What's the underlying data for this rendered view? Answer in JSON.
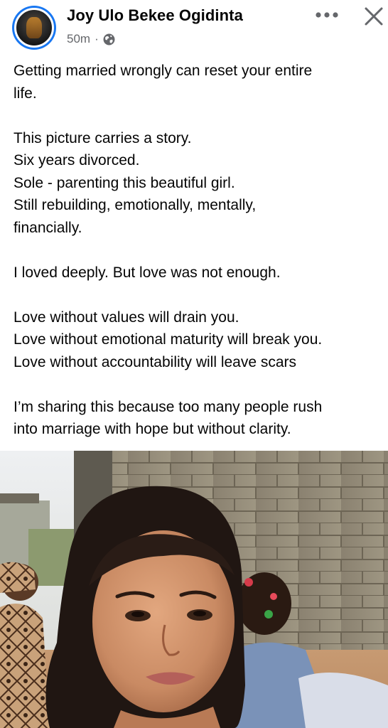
{
  "post": {
    "author": "Joy Ulo Bekee Ogidinta",
    "time": "50m",
    "separator": "·",
    "privacy_icon": "globe-icon",
    "more_icon": "more-horizontal-icon",
    "close_icon": "close-icon"
  },
  "body": {
    "paragraph1": [
      "Getting married wrongly can reset your entire",
      "life."
    ],
    "paragraph2": [
      "This picture carries a story.",
      "Six years divorced.",
      "Sole - parenting this beautiful girl.",
      "Still rebuilding, emotionally, mentally,",
      "financially."
    ],
    "paragraph3": [
      "I loved deeply. But love was not enough."
    ],
    "paragraph4": [
      "Love without values will drain you.",
      "Love without emotional maturity will break you.",
      "Love without accountability will leave scars"
    ],
    "paragraph5": [
      "I’m sharing this because too many people rush",
      "into marriage with hope but without clarity."
    ]
  },
  "colors": {
    "text": "#050505",
    "meta": "#65676b",
    "avatar_ring": "#1877f2"
  }
}
